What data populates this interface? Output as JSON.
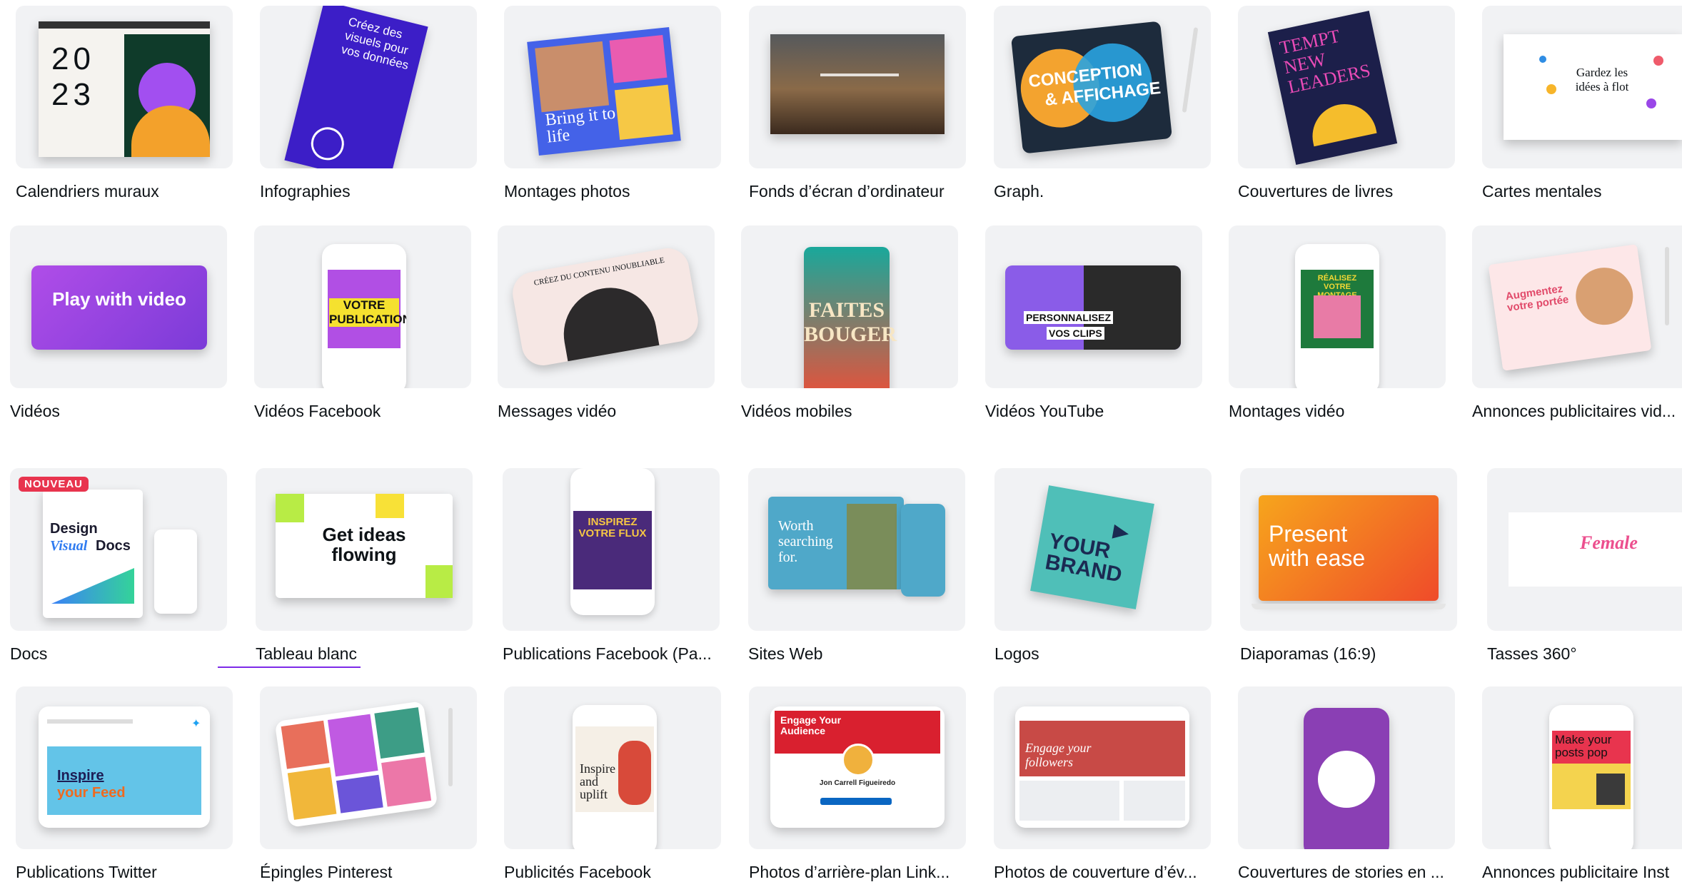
{
  "colors": {
    "accent": "#7d2ae8",
    "thumb_bg": "#f1f2f4",
    "badge_new": "#e8344e"
  },
  "tiles": [
    {
      "label": "Calendriers muraux",
      "thumb_text": [
        "20",
        "23"
      ]
    },
    {
      "label": "Infographies",
      "thumb_text": [
        "Créez des visuels pour vos données"
      ]
    },
    {
      "label": "Montages photos",
      "thumb_text": [
        "Bring it to life"
      ]
    },
    {
      "label": "Fonds d’écran d’ordinateur"
    },
    {
      "label": "Graph.",
      "thumb_text": [
        "CONCEPTION",
        "& AFFICHAGE"
      ]
    },
    {
      "label": "Couvertures de livres",
      "thumb_text": [
        "TEMPT NEW LEADERS"
      ]
    },
    {
      "label": "Cartes mentales",
      "thumb_text": [
        "Gardez les idées à flot"
      ]
    },
    {
      "label": "Vidéos",
      "thumb_text": [
        "Play with video"
      ]
    },
    {
      "label": "Vidéos Facebook",
      "thumb_text": [
        "VOTRE PUBLICATION"
      ]
    },
    {
      "label": "Messages vidéo",
      "thumb_text": [
        "CRÉEZ DU CONTENU INOUBLIABLE"
      ]
    },
    {
      "label": "Vidéos mobiles",
      "thumb_text": [
        "FAITES BOUGER"
      ]
    },
    {
      "label": "Vidéos YouTube",
      "thumb_text": [
        "PERSONNALISEZ",
        "VOS CLIPS"
      ]
    },
    {
      "label": "Montages vidéo",
      "thumb_text": [
        "RÉALISEZ VOTRE MONTAGE"
      ]
    },
    {
      "label": "Annonces publicitaires vid...",
      "thumb_text": [
        "Augmentez votre portée"
      ]
    },
    {
      "label": "Docs",
      "badge": "NOUVEAU",
      "thumb_text": [
        "Design",
        "Visual",
        "Docs"
      ]
    },
    {
      "label": "Tableau blanc",
      "thumb_text": [
        "Get ideas",
        "flowing"
      ]
    },
    {
      "label": "Publications Facebook (Pa...",
      "thumb_text": [
        "INSPIREZ VOTRE FLUX"
      ]
    },
    {
      "label": "Sites Web",
      "thumb_text": [
        "Worth searching for."
      ]
    },
    {
      "label": "Logos",
      "thumb_text": [
        "YOUR",
        "BRAND"
      ]
    },
    {
      "label": "Diaporamas (16:9)",
      "thumb_text": [
        "Present",
        "with ease"
      ]
    },
    {
      "label": "Tasses 360°",
      "thumb_text": [
        "Female"
      ]
    },
    {
      "label": "Publications Twitter",
      "thumb_text": [
        "Inspire",
        "your Feed"
      ]
    },
    {
      "label": "Épingles Pinterest"
    },
    {
      "label": "Publicités Facebook",
      "thumb_text": [
        "Inspire and uplift"
      ]
    },
    {
      "label": "Photos d’arrière-plan Link...",
      "thumb_text": [
        "Engage Your Audience",
        "Jon Carrell Figueiredo"
      ]
    },
    {
      "label": "Photos de couverture d’év...",
      "thumb_text": [
        "Engage your followers"
      ]
    },
    {
      "label": "Couvertures de stories en ..."
    },
    {
      "label": "Annonces publicitaire Inst",
      "thumb_text": [
        "Make your posts pop"
      ]
    }
  ]
}
